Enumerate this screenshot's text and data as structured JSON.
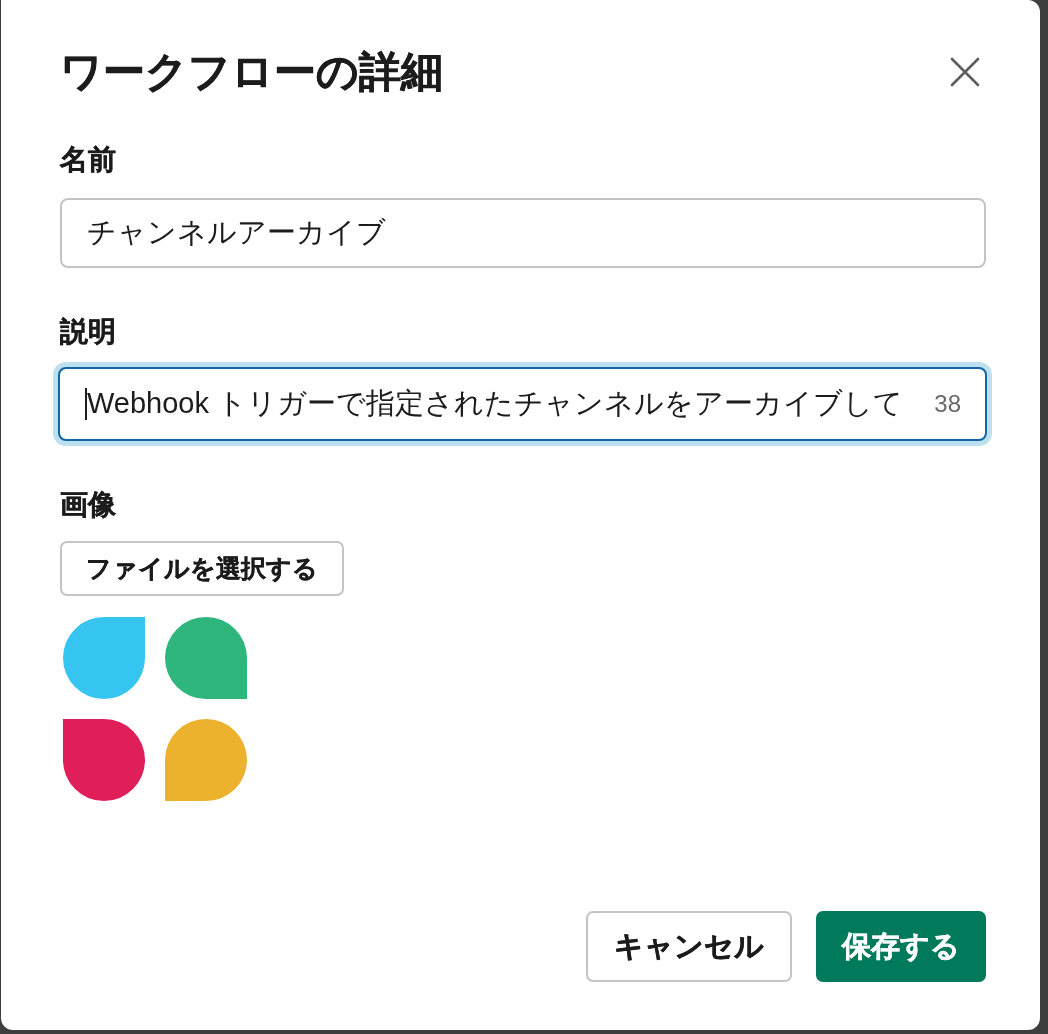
{
  "dialog": {
    "title": "ワークフローの詳細"
  },
  "fields": [
    {
      "label": "名前",
      "value": "チャンネルアーカイブ",
      "focused": false
    },
    {
      "label": "説明",
      "value": "Webhook トリガーで指定されたチャンネルをアーカイブして",
      "focused": true,
      "counter": "38"
    }
  ],
  "image": {
    "label": "画像",
    "button": "ファイルを選択する"
  },
  "buttons": [
    {
      "label": "キャンセル",
      "kind": "secondary"
    },
    {
      "label": "保存する",
      "kind": "primary"
    }
  ]
}
